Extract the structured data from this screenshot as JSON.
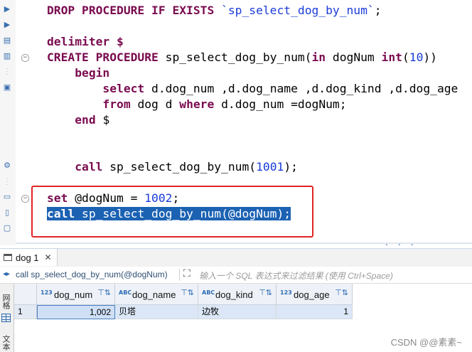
{
  "editor": {
    "lines": [
      {
        "row": 0,
        "tokens": [
          {
            "t": "DROP PROCEDURE IF EXISTS ",
            "c": "kw"
          },
          {
            "t": "`sp_select_dog_by_num`",
            "c": "str"
          },
          {
            "t": ";",
            "c": ""
          }
        ]
      },
      {
        "row": 2,
        "tokens": [
          {
            "t": "delimiter $",
            "c": "kw"
          }
        ]
      },
      {
        "row": 3,
        "tokens": [
          {
            "t": "CREATE PROCEDURE ",
            "c": "kw"
          },
          {
            "t": "sp_select_dog_by_num(",
            "c": ""
          },
          {
            "t": "in",
            "c": "kw"
          },
          {
            "t": " dogNum ",
            "c": ""
          },
          {
            "t": "int",
            "c": "kw"
          },
          {
            "t": "(",
            "c": ""
          },
          {
            "t": "10",
            "c": "num"
          },
          {
            "t": "))",
            "c": ""
          }
        ]
      },
      {
        "row": 4,
        "tokens": [
          {
            "t": "    ",
            "c": ""
          },
          {
            "t": "begin",
            "c": "kw"
          }
        ]
      },
      {
        "row": 5,
        "tokens": [
          {
            "t": "        ",
            "c": ""
          },
          {
            "t": "select",
            "c": "kw"
          },
          {
            "t": " d.dog_num ,d.dog_name ,d.dog_kind ,d.dog_age",
            "c": ""
          }
        ]
      },
      {
        "row": 6,
        "tokens": [
          {
            "t": "        ",
            "c": ""
          },
          {
            "t": "from",
            "c": "kw"
          },
          {
            "t": " dog d ",
            "c": ""
          },
          {
            "t": "where",
            "c": "kw"
          },
          {
            "t": " d.dog_num =dogNum;",
            "c": ""
          }
        ]
      },
      {
        "row": 7,
        "tokens": [
          {
            "t": "    ",
            "c": ""
          },
          {
            "t": "end",
            "c": "kw"
          },
          {
            "t": " $",
            "c": ""
          }
        ]
      },
      {
        "row": 10,
        "tokens": [
          {
            "t": "    ",
            "c": ""
          },
          {
            "t": "call",
            "c": "kw"
          },
          {
            "t": " sp_select_dog_by_num(",
            "c": ""
          },
          {
            "t": "1001",
            "c": "num"
          },
          {
            "t": ");",
            "c": ""
          }
        ]
      },
      {
        "row": 12,
        "tokens": [
          {
            "t": "set",
            "c": "kw"
          },
          {
            "t": " @dogNum = ",
            "c": ""
          },
          {
            "t": "1002",
            "c": "num"
          },
          {
            "t": ";",
            "c": ""
          }
        ]
      },
      {
        "row": 13,
        "selected": true,
        "tokens": [
          {
            "t": "call",
            "c": "kw"
          },
          {
            "t": " sp_select_dog_by_num(@dogNum);",
            "c": ""
          }
        ]
      }
    ],
    "fold_markers": [
      3,
      12
    ]
  },
  "results": {
    "tab_label": "dog 1",
    "query_text": "call sp_select_dog_by_num(@dogNum)",
    "filter_placeholder": "输入一个 SQL 表达式来过滤结果 (使用 Ctrl+Space)",
    "side_tabs": [
      "网格",
      "文本"
    ],
    "columns": [
      {
        "type_badge": "123",
        "name": "dog_num"
      },
      {
        "type_badge": "ABC",
        "name": "dog_name"
      },
      {
        "type_badge": "ABC",
        "name": "dog_kind"
      },
      {
        "type_badge": "123",
        "name": "dog_age"
      }
    ],
    "rows": [
      {
        "index": "1",
        "cells": [
          "1,002",
          "贝塔",
          "边牧",
          "1"
        ]
      }
    ]
  },
  "watermark": "CSDN @@素素~",
  "colors": {
    "keyword": "#7a0b4f",
    "number": "#1a3cd8",
    "selection": "#1c62b3",
    "highlight_box": "#e02424"
  }
}
